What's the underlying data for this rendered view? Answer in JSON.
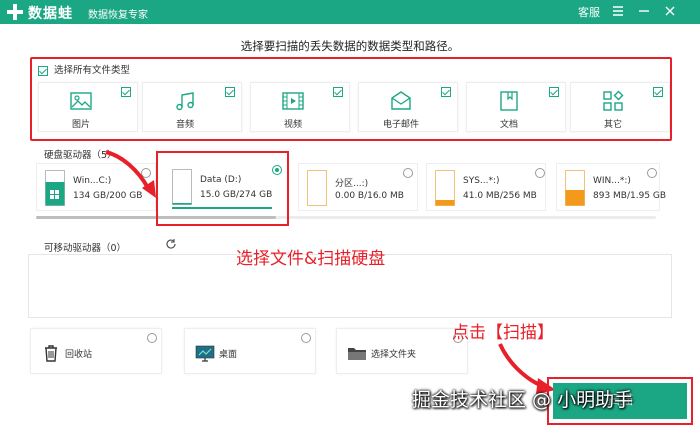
{
  "titlebar": {
    "app_name": "数据蛙",
    "subtitle": "数据恢复专家",
    "service": "客服",
    "bg_color": "#1ba784"
  },
  "heading": "选择要扫描的丢失数据的数据类型和路径。",
  "file_types": {
    "select_all": "选择所有文件类型",
    "items": [
      {
        "label": "图片",
        "icon": "image-icon",
        "checked": true
      },
      {
        "label": "音频",
        "icon": "music-icon",
        "checked": true
      },
      {
        "label": "视频",
        "icon": "video-icon",
        "checked": true
      },
      {
        "label": "电子邮件",
        "icon": "email-icon",
        "checked": true
      },
      {
        "label": "文档",
        "icon": "document-icon",
        "checked": true
      },
      {
        "label": "其它",
        "icon": "other-icon",
        "checked": true
      }
    ]
  },
  "hard_drives": {
    "label": "硬盘驱动器（5）",
    "items": [
      {
        "name": "Win...C:)",
        "size": "134 GB/200 GB",
        "selected": false,
        "fill": 0.67
      },
      {
        "name": "Data (D:)",
        "size": "15.0 GB/274 GB",
        "selected": true,
        "fill": 0.05
      },
      {
        "name": "分区...:)",
        "size": "0.00  B/16.0 MB",
        "selected": false,
        "fill": 0.0
      },
      {
        "name": "SYS...*:)",
        "size": "41.0 MB/256 MB",
        "selected": false,
        "fill": 0.16
      },
      {
        "name": "WIN...*:)",
        "size": "893 MB/1.95 GB",
        "selected": false,
        "fill": 0.45
      }
    ]
  },
  "removable": {
    "label": "可移动驱动器（0）"
  },
  "locations": [
    {
      "label": "回收站",
      "icon": "recycle-bin-icon"
    },
    {
      "label": "桌面",
      "icon": "desktop-icon"
    },
    {
      "label": "选择文件夹",
      "icon": "folder-icon"
    }
  ],
  "scan_button": "扫描",
  "annotations": {
    "select_files": "选择文件&扫描硬盘",
    "click_scan": "点击【扫描】"
  },
  "watermark": "掘金技术社区 @ 小明助手",
  "colors": {
    "accent": "#1ba784",
    "highlight": "#e8202a",
    "drive_fill": "#1ba784",
    "drive_fill_alt": "#f39a1d"
  }
}
